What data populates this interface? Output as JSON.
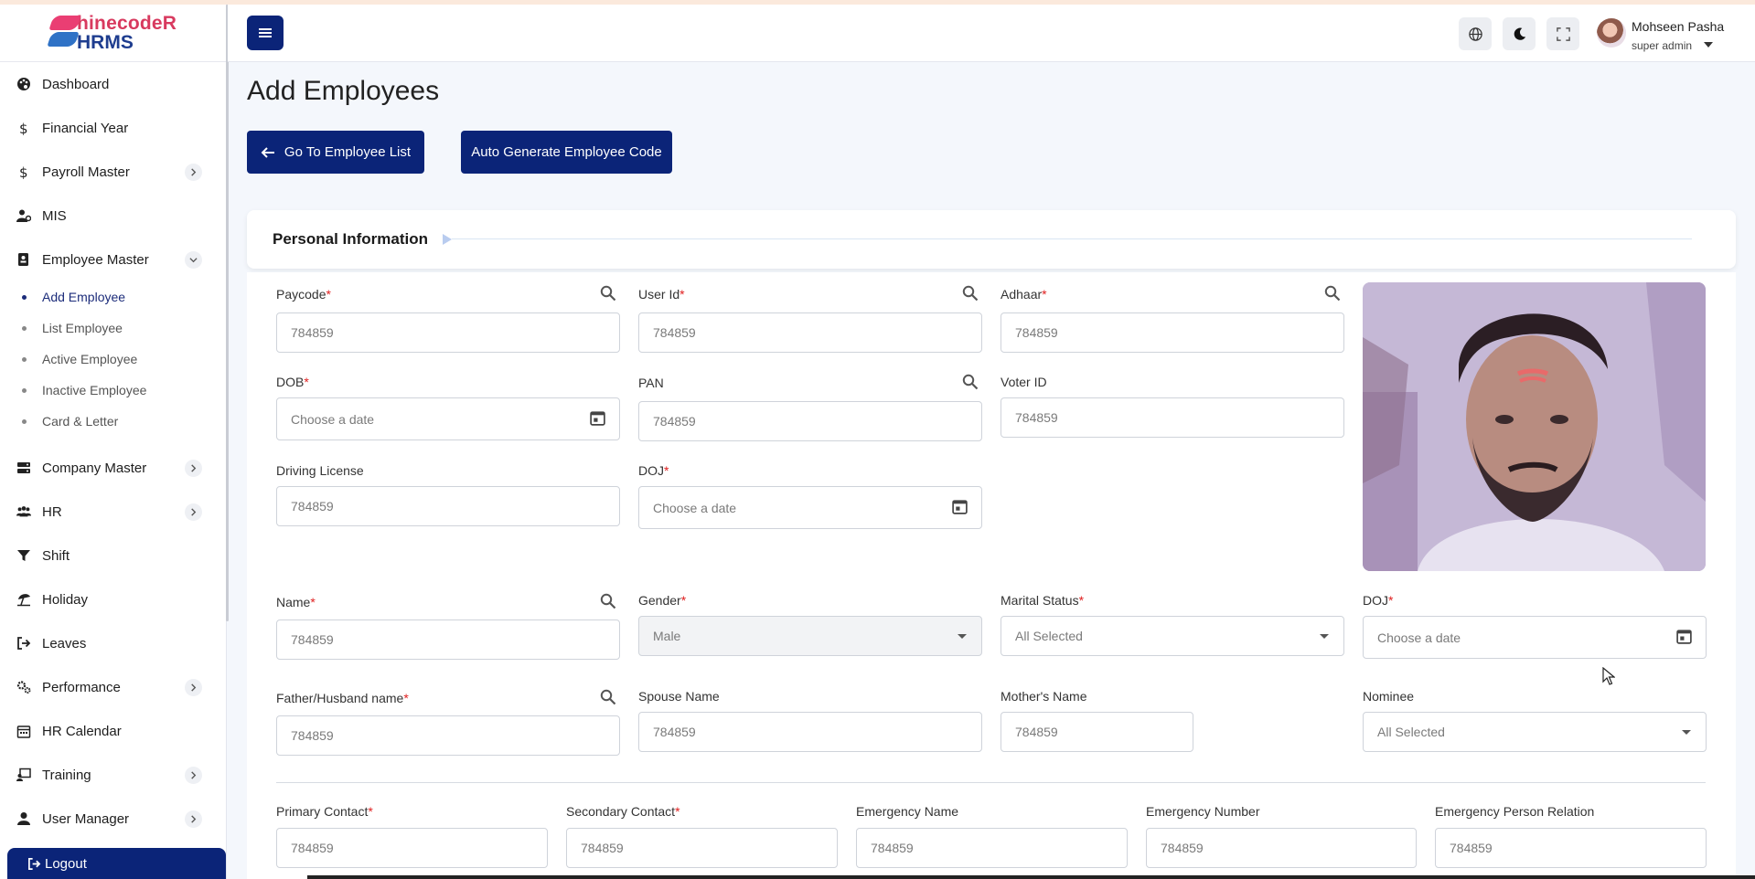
{
  "brand": {
    "line1": "hinecodeR",
    "line2": "HRMS"
  },
  "sidebar": {
    "items": [
      {
        "label": "Dashboard",
        "icon": "palette-icon"
      },
      {
        "label": "Financial Year",
        "icon": "dollar-icon"
      },
      {
        "label": "Payroll Master",
        "icon": "dollar-icon",
        "chevron": "right"
      },
      {
        "label": "MIS",
        "icon": "user-gear-icon"
      },
      {
        "label": "Employee Master",
        "icon": "id-badge-icon",
        "chevron": "down"
      },
      {
        "label": "Company Master",
        "icon": "server-icon",
        "chevron": "right"
      },
      {
        "label": "HR",
        "icon": "users-icon",
        "chevron": "right"
      },
      {
        "label": "Shift",
        "icon": "filter-icon"
      },
      {
        "label": "Holiday",
        "icon": "umbrella-beach-icon"
      },
      {
        "label": "Leaves",
        "icon": "sign-out-icon"
      },
      {
        "label": "Performance",
        "icon": "gears-icon",
        "chevron": "right"
      },
      {
        "label": "HR Calendar",
        "icon": "calendar-icon"
      },
      {
        "label": "Training",
        "icon": "chalkboard-icon",
        "chevron": "right"
      },
      {
        "label": "User Manager",
        "icon": "user-icon",
        "chevron": "right"
      }
    ],
    "employee_sub": [
      {
        "label": "Add Employee",
        "active": true
      },
      {
        "label": "List Employee",
        "active": false
      },
      {
        "label": "Active Employee",
        "active": false
      },
      {
        "label": "Inactive Employee",
        "active": false
      },
      {
        "label": "Card & Letter",
        "active": false
      }
    ],
    "logout": "Logout"
  },
  "header": {
    "user_name": "Mohseen Pasha",
    "user_role": "super admin"
  },
  "page": {
    "title": "Add Employees",
    "btn_back": "Go To Employee List",
    "btn_auto": "Auto Generate Employee Code",
    "section_title": "Personal Information"
  },
  "fields": {
    "paycode": {
      "label": "Paycode",
      "value": "784859"
    },
    "user_id": {
      "label": "User Id",
      "value": "784859"
    },
    "adhaar": {
      "label": "Adhaar",
      "value": "784859"
    },
    "dob": {
      "label": "DOB",
      "placeholder": "Choose a date"
    },
    "pan": {
      "label": "PAN",
      "value": "784859"
    },
    "voter_id": {
      "label": "Voter ID",
      "value": "784859"
    },
    "driving_license": {
      "label": "Driving License",
      "value": "784859"
    },
    "doj1": {
      "label": "DOJ",
      "placeholder": "Choose a date"
    },
    "name": {
      "label": "Name",
      "value": "784859"
    },
    "gender": {
      "label": "Gender",
      "value": "Male"
    },
    "marital_status": {
      "label": "Marital Status",
      "value": "All Selected"
    },
    "doj2": {
      "label": "DOJ",
      "placeholder": "Choose a date"
    },
    "father_name": {
      "label": "Father/Husband name",
      "value": "784859"
    },
    "spouse_name": {
      "label": "Spouse Name",
      "value": "784859"
    },
    "mother_name": {
      "label": "Mother's Name",
      "value": "784859"
    },
    "nominee": {
      "label": "Nominee",
      "value": "All Selected"
    },
    "primary_contact": {
      "label": "Primary Contact",
      "value": "784859"
    },
    "secondary_contact": {
      "label": "Secondary Contact",
      "value": "784859"
    },
    "emergency_name": {
      "label": "Emergency Name",
      "value": "784859"
    },
    "emergency_number": {
      "label": "Emergency Number",
      "value": "784859"
    },
    "emergency_relation": {
      "label": "Emergency Person Relation",
      "value": "784859"
    }
  },
  "required_mark": "*",
  "colors": {
    "primary": "#0b2478",
    "required": "#e02020",
    "brand_pink": "#ea3e73",
    "brand_blue": "#2f72c6"
  }
}
